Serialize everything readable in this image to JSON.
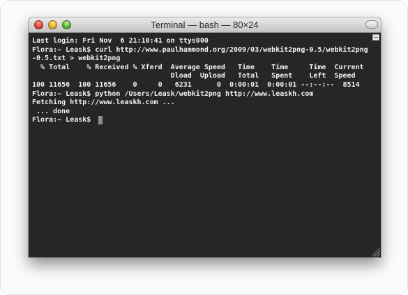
{
  "window": {
    "title": "Terminal — bash — 80×24"
  },
  "terminal": {
    "lines": [
      "Last login: Fri Nov  6 21:10:41 on ttys000",
      "Flora:~ Leask$ curl http://www.paulhammond.org/2009/03/webkit2png-0.5/webkit2png",
      "-0.5.txt > webkit2png",
      "  % Total    % Received % Xferd  Average Speed   Time    Time     Time  Current",
      "                                 Dload  Upload   Total   Spent    Left  Speed",
      "100 11656  100 11656    0     0   6231      0  0:00:01  0:00:01 --:--:--  8514",
      "Flora:~ Leask$ python /Users/Leask/webkit2png http://www.leaskh.com",
      "Fetching http://www.leaskh.com ...",
      " ... done",
      "Flora:~ Leask$"
    ]
  },
  "icons": {
    "close": "close-button-icon",
    "minimize": "minimize-button-icon",
    "zoom": "zoom-button-icon",
    "split": "split-pane-icon",
    "resize": "resize-grip-icon"
  },
  "colors": {
    "terminal_background": "#262626",
    "terminal_text": "#f2f2f2",
    "cursor": "#8f8f8f"
  }
}
